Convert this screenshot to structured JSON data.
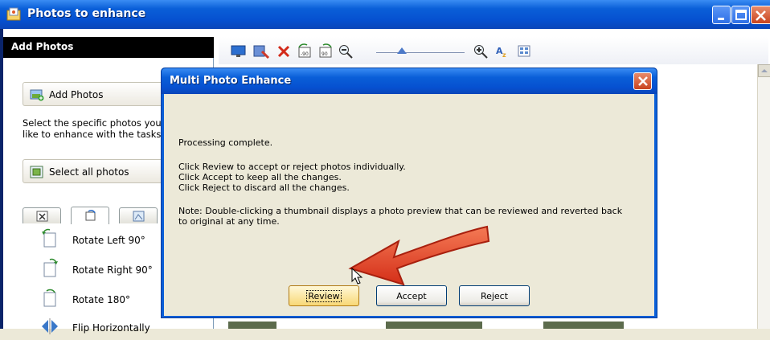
{
  "window": {
    "title": "Photos to enhance",
    "icon": "photo-folder-icon"
  },
  "left_pane": {
    "header": "Add Photos",
    "add_photos_label": "Add Photos",
    "instruction_line1": "Select the specific photos you",
    "instruction_line2": "like to enhance with the tasks",
    "select_all_label": "Select all photos",
    "tabs": [
      "adjust-tab",
      "rotate-tab",
      "effects-tab"
    ],
    "tasks": [
      {
        "label": "Rotate Left 90°",
        "icon": "rotate-left-icon"
      },
      {
        "label": "Rotate Right 90°",
        "icon": "rotate-right-icon"
      },
      {
        "label": "Rotate 180°",
        "icon": "rotate-180-icon"
      },
      {
        "label": "Flip Horizontally",
        "icon": "flip-horizontal-icon"
      }
    ]
  },
  "toolbar": {
    "icons": [
      "slideshow-icon",
      "enhance-icon",
      "delete-icon",
      "rotate-left-icon",
      "rotate-right-icon",
      "zoom-out-icon",
      "zoom-slider",
      "zoom-in-icon",
      "sort-icon",
      "view-icon"
    ]
  },
  "dialog": {
    "title": "Multi Photo Enhance",
    "status": "Processing complete.",
    "line1": "Click Review to accept or reject photos individually.",
    "line2": "Click Accept to keep all the changes.",
    "line3": "Click Reject to discard all the changes.",
    "note1": "Note: Double-clicking a thumbnail displays a photo preview that can be reviewed and reverted back",
    "note2": "to original at any time.",
    "review": "Review",
    "accept": "Accept",
    "reject": "Reject"
  },
  "colors": {
    "titlebar": "#0A5FD8",
    "dialog_bg": "#ECE9D8",
    "arrow": "#E8432A"
  }
}
